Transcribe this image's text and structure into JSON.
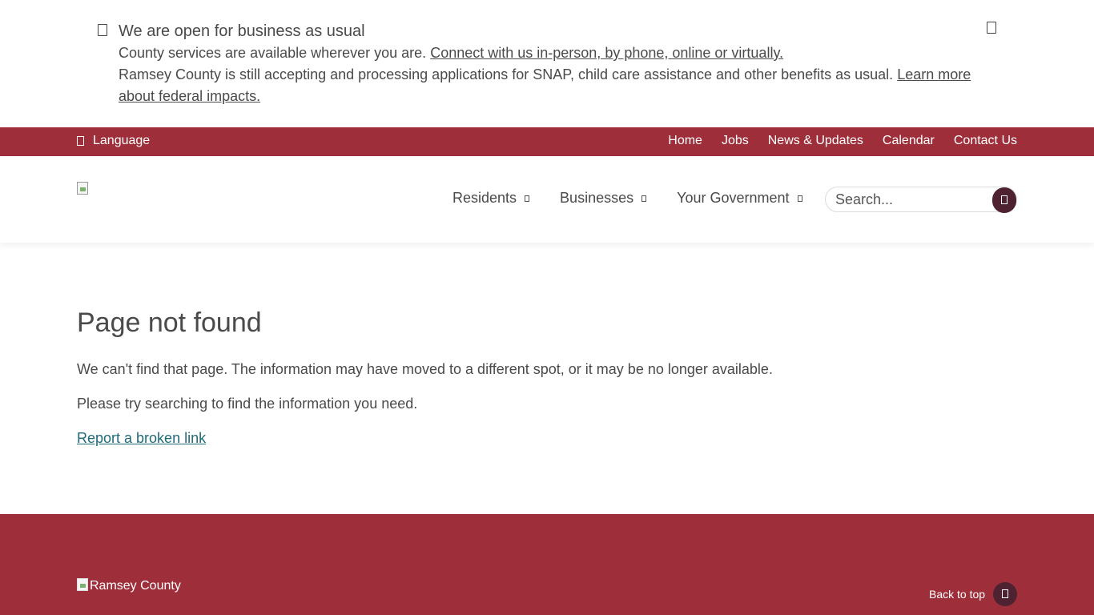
{
  "alert": {
    "title": "We are open for business as usual",
    "line1_text": "County services are available wherever you are. ",
    "line1_link": "Connect with us in-person, by phone, online or virtually.",
    "line2_text": "Ramsey County is still accepting and processing applications for SNAP, child care assistance and other benefits as usual. ",
    "line2_link": "Learn more about federal impacts.",
    "info_icon": "info-icon",
    "close_icon": "close-icon"
  },
  "utility": {
    "language_label": "Language",
    "language_icon": "globe-icon",
    "links": [
      "Home",
      "Jobs",
      "News & Updates",
      "Calendar",
      "Contact Us"
    ]
  },
  "header": {
    "nav": [
      {
        "label": "Residents"
      },
      {
        "label": "Businesses"
      },
      {
        "label": "Your Government"
      }
    ],
    "search": {
      "placeholder": "Search..."
    }
  },
  "main": {
    "title": "Page not found",
    "para1": "We can't find that page. The information may have moved to a different spot, or it may be no longer available.",
    "para2": "Please try searching to find the information you need.",
    "report_link": "Report a broken link"
  },
  "footer": {
    "logo_alt": "Ramsey County",
    "back_to_top": "Back to top"
  },
  "colors": {
    "brand": "#9e2f3a",
    "accent_dark": "#4e2230",
    "link": "#1f6b78"
  }
}
